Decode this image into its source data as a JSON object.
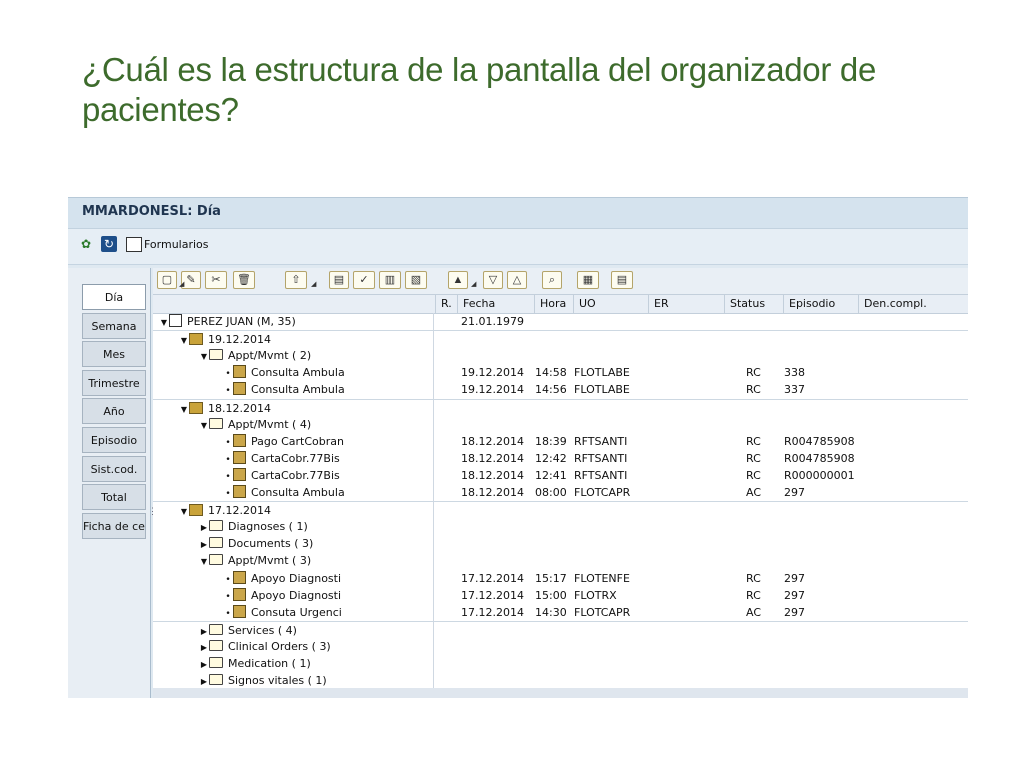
{
  "slide": {
    "title": "¿Cuál  es la estructura de la pantalla del organizador de pacientes?"
  },
  "sap": {
    "title": "MMARDONESL: Día",
    "app_toolbar": {
      "formularios": "Formularios"
    },
    "tabs": [
      "Día",
      "Semana",
      "Mes",
      "Trimestre",
      "Año",
      "Episodio",
      "Sist.cod.",
      "Total",
      "Ficha de ce"
    ],
    "columns": [
      "R.",
      "Fecha",
      "Hora",
      "UO",
      "ER",
      "Status",
      "Episodio",
      "Den.compl."
    ],
    "rows": [
      {
        "kind": "patient",
        "indent": 0,
        "tw": "▼",
        "icon": "patient-icon",
        "label": "PEREZ JUAN (M, 35)",
        "fecha": "21.01.1979",
        "hora": "",
        "uo": "",
        "status": "",
        "episodio": ""
      },
      {
        "kind": "date",
        "indent": 1,
        "tw": "▼",
        "icon": "calendar-icon",
        "label": "19.12.2014",
        "fecha": "",
        "hora": "",
        "uo": "",
        "status": "",
        "episodio": ""
      },
      {
        "kind": "folder",
        "indent": 2,
        "tw": "▼",
        "icon": "folder-icon",
        "label": "Appt/Mvmt ( 2)",
        "fecha": "",
        "hora": "",
        "uo": "",
        "status": "",
        "episodio": ""
      },
      {
        "kind": "item",
        "indent": 3,
        "tw": "•",
        "icon": "appointment-icon",
        "label": "Consulta Ambula",
        "fecha": "19.12.2014",
        "hora": "14:58",
        "uo": "FLOTLABE",
        "status": "RC",
        "episodio": "338"
      },
      {
        "kind": "item",
        "indent": 3,
        "tw": "•",
        "icon": "appointment-icon",
        "label": "Consulta Ambula",
        "fecha": "19.12.2014",
        "hora": "14:56",
        "uo": "FLOTLABE",
        "status": "RC",
        "episodio": "337"
      },
      {
        "kind": "date",
        "indent": 1,
        "tw": "▼",
        "icon": "calendar-icon",
        "label": "18.12.2014",
        "fecha": "",
        "hora": "",
        "uo": "",
        "status": "",
        "episodio": ""
      },
      {
        "kind": "folder",
        "indent": 2,
        "tw": "▼",
        "icon": "folder-icon",
        "label": "Appt/Mvmt ( 4)",
        "fecha": "",
        "hora": "",
        "uo": "",
        "status": "",
        "episodio": ""
      },
      {
        "kind": "item",
        "indent": 3,
        "tw": "•",
        "icon": "appointment-icon",
        "label": "Pago CartCobran",
        "fecha": "18.12.2014",
        "hora": "18:39",
        "uo": "RFTSANTI",
        "status": "RC",
        "episodio": "R004785908"
      },
      {
        "kind": "item",
        "indent": 3,
        "tw": "•",
        "icon": "appointment-icon",
        "label": "CartaCobr.77Bis",
        "fecha": "18.12.2014",
        "hora": "12:42",
        "uo": "RFTSANTI",
        "status": "RC",
        "episodio": "R004785908"
      },
      {
        "kind": "item",
        "indent": 3,
        "tw": "•",
        "icon": "appointment-icon",
        "label": "CartaCobr.77Bis",
        "fecha": "18.12.2014",
        "hora": "12:41",
        "uo": "RFTSANTI",
        "status": "RC",
        "episodio": "R000000001"
      },
      {
        "kind": "item",
        "indent": 3,
        "tw": "•",
        "icon": "appointment-icon",
        "label": "Consulta Ambula",
        "fecha": "18.12.2014",
        "hora": "08:00",
        "uo": "FLOTCAPR",
        "status": "AC",
        "episodio": "297"
      },
      {
        "kind": "date",
        "indent": 1,
        "tw": "▼",
        "icon": "calendar-icon",
        "label": "17.12.2014",
        "fecha": "",
        "hora": "",
        "uo": "",
        "status": "",
        "episodio": ""
      },
      {
        "kind": "folder",
        "indent": 2,
        "tw": "▶",
        "icon": "folder-icon",
        "label": "Diagnoses ( 1)",
        "fecha": "",
        "hora": "",
        "uo": "",
        "status": "",
        "episodio": ""
      },
      {
        "kind": "folder",
        "indent": 2,
        "tw": "▶",
        "icon": "folder-icon",
        "label": "Documents ( 3)",
        "fecha": "",
        "hora": "",
        "uo": "",
        "status": "",
        "episodio": ""
      },
      {
        "kind": "folder",
        "indent": 2,
        "tw": "▼",
        "icon": "folder-icon",
        "label": "Appt/Mvmt ( 3)",
        "fecha": "",
        "hora": "",
        "uo": "",
        "status": "",
        "episodio": ""
      },
      {
        "kind": "item",
        "indent": 3,
        "tw": "•",
        "icon": "appointment-icon",
        "label": "Apoyo Diagnosti",
        "fecha": "17.12.2014",
        "hora": "15:17",
        "uo": "FLOTENFE",
        "status": "RC",
        "episodio": "297"
      },
      {
        "kind": "item",
        "indent": 3,
        "tw": "•",
        "icon": "appointment-icon",
        "label": "Apoyo Diagnosti",
        "fecha": "17.12.2014",
        "hora": "15:00",
        "uo": "FLOTRX",
        "status": "RC",
        "episodio": "297"
      },
      {
        "kind": "item",
        "indent": 3,
        "tw": "•",
        "icon": "appointment-icon",
        "label": "Consuta Urgenci",
        "fecha": "17.12.2014",
        "hora": "14:30",
        "uo": "FLOTCAPR",
        "status": "AC",
        "episodio": "297"
      },
      {
        "kind": "folder",
        "indent": 2,
        "tw": "▶",
        "icon": "folder-icon",
        "label": "Services ( 4)",
        "fecha": "",
        "hora": "",
        "uo": "",
        "status": "",
        "episodio": ""
      },
      {
        "kind": "folder",
        "indent": 2,
        "tw": "▶",
        "icon": "folder-icon",
        "label": "Clinical Orders ( 3)",
        "fecha": "",
        "hora": "",
        "uo": "",
        "status": "",
        "episodio": ""
      },
      {
        "kind": "folder",
        "indent": 2,
        "tw": "▶",
        "icon": "folder-icon",
        "label": "Medication ( 1)",
        "fecha": "",
        "hora": "",
        "uo": "",
        "status": "",
        "episodio": ""
      },
      {
        "kind": "folder",
        "indent": 2,
        "tw": "▶",
        "icon": "folder-icon",
        "label": "Signos vitales ( 1)",
        "fecha": "",
        "hora": "",
        "uo": "",
        "status": "",
        "episodio": ""
      }
    ],
    "toolbar_icons": [
      "new-icon",
      "edit-icon",
      "change-icon",
      "delete-icon",
      "export-icon",
      "print-icon",
      "check-icon",
      "layout-icon",
      "picture-icon",
      "person-icon",
      "filter-down-icon",
      "filter-up-icon",
      "find-icon",
      "grid-icon",
      "details-icon"
    ]
  }
}
